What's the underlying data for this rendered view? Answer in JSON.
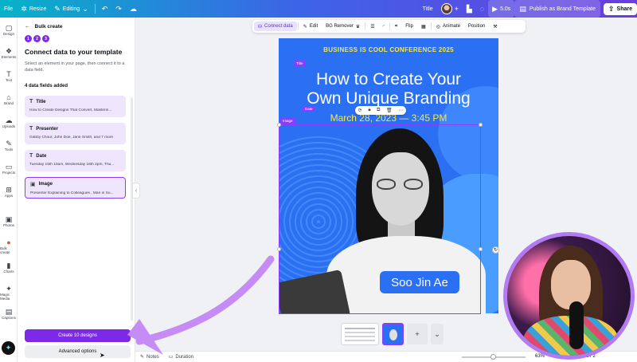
{
  "topbar": {
    "file": "File",
    "resize": "Resize",
    "editing": "Editing",
    "title": "Title",
    "timer": "5.0s",
    "publish": "Publish as Brand Template",
    "share": "Share"
  },
  "rail": [
    {
      "name": "design",
      "label": "Design",
      "icon": "▢"
    },
    {
      "name": "elements",
      "label": "Elements",
      "icon": "❖"
    },
    {
      "name": "text",
      "label": "Text",
      "icon": "T"
    },
    {
      "name": "brand",
      "label": "Brand",
      "icon": "⌂"
    },
    {
      "name": "uploads",
      "label": "Uploads",
      "icon": "☁"
    },
    {
      "name": "tools",
      "label": "Tools",
      "icon": "✎"
    },
    {
      "name": "projects",
      "label": "Projects",
      "icon": "▭"
    },
    {
      "name": "apps",
      "label": "Apps",
      "icon": "⊞"
    },
    {
      "name": "photos",
      "label": "Photos",
      "icon": "▣"
    },
    {
      "name": "bulk-create",
      "label": "Bulk create",
      "icon": "●"
    },
    {
      "name": "charts",
      "label": "Charts",
      "icon": "▮"
    },
    {
      "name": "magic-media",
      "label": "Magic Media",
      "icon": "✦"
    },
    {
      "name": "captions",
      "label": "Captions",
      "icon": "▤"
    }
  ],
  "panel": {
    "header": "Bulk create",
    "steps": [
      "1",
      "2",
      "3"
    ],
    "title": "Connect data to your template",
    "description": "Select an element in your page, then connect it to a data field.",
    "fields_added": "4 data fields added",
    "fields": [
      {
        "icon": "T",
        "name": "Title",
        "sample": "How to Create Designs That Convert, Masterin..."
      },
      {
        "icon": "T",
        "name": "Presenter",
        "sample": "Gabby Chour, John Doe, Jane Smith, and 7 more"
      },
      {
        "icon": "T",
        "name": "Date",
        "sample": "Tuesday 15th 10am, Wednesday 16th 2pm, Thu..."
      },
      {
        "icon": "▣",
        "name": "Image",
        "sample": "Presenter Explaining to Colleagues , Man in Su..."
      }
    ],
    "primary_button": "Create 10 designs",
    "secondary_button": "Advanced options"
  },
  "context_toolbar": {
    "connect_data": "Connect data",
    "edit": "Edit",
    "bg_remover": "BG Remover",
    "flip": "Flip",
    "animate": "Animate",
    "position": "Position"
  },
  "design": {
    "conference": "BUSINESS IS COOL CONFERENCE 2025",
    "title_line1": "How to Create Your",
    "title_line2": "Own Unique Branding",
    "date": "March 28, 2023  —  3:45 PM",
    "name_tag": "Soo Jin Ae",
    "tag_title": "Title",
    "tag_date": "Date",
    "tag_image": "Image"
  },
  "bottombar": {
    "notes": "Notes",
    "duration": "Duration",
    "zoom": "63%",
    "pages": "2 / 2"
  },
  "colors": {
    "accent": "#8b3dff",
    "primary_button": "#7d2ae8",
    "design_bg": "#2b6ff2",
    "highlight_yellow": "#f5e84a",
    "arrow": "#c58cf5"
  }
}
